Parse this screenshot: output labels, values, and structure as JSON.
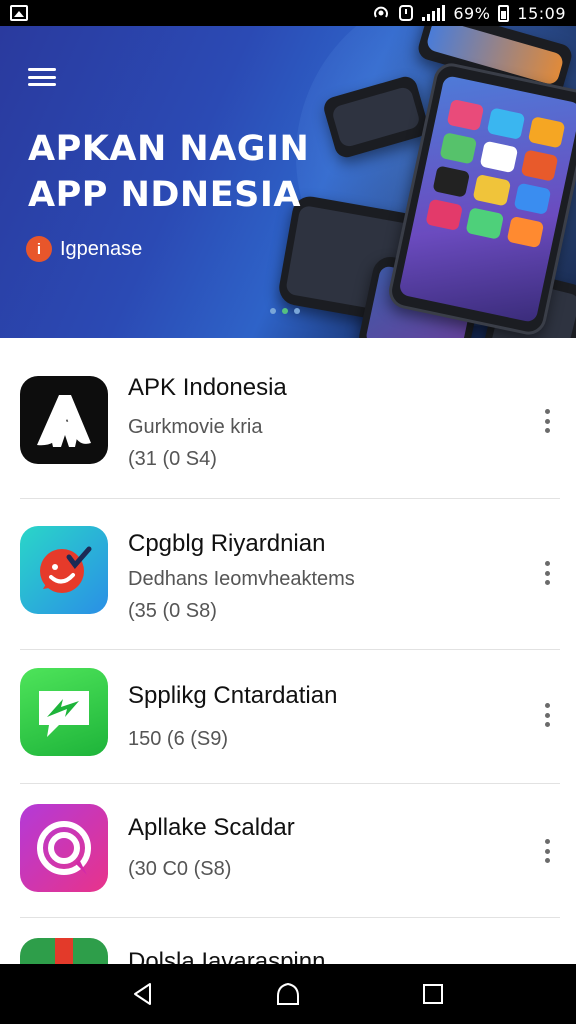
{
  "status_bar": {
    "battery_text": "69%",
    "time": "15:09",
    "icons": [
      "gallery-icon",
      "hotspot-icon",
      "alarm-icon",
      "signal-icon",
      "battery-icon"
    ]
  },
  "banner": {
    "title_line1": "APKAN NAGIN",
    "title_line2": "APP NDNESIA",
    "brand": "Igpenase",
    "brand_logo_glyph": "i",
    "slide_count": 3,
    "active_slide": 2
  },
  "apps": [
    {
      "name": "APK Indonesia",
      "subtitle": "Gurkmovie kria",
      "meta": "(31 (0 S4)",
      "icon": "apk-logo-icon",
      "colors": [
        "#0d0d0d"
      ]
    },
    {
      "name": "Cpgblg Riyardnian",
      "subtitle": "Dedhans Ieomvheaktems",
      "meta": "(35 (0 S8)",
      "icon": "chat-bubble-face-icon",
      "colors": [
        "#2ad6c8",
        "#2a8fe6",
        "#e63a2a"
      ]
    },
    {
      "name": "Spplikg Cntardatian",
      "subtitle": "",
      "meta": "150 (6 (S9)",
      "icon": "message-arrow-icon",
      "colors": [
        "#4ee45a",
        "#1eb43a"
      ]
    },
    {
      "name": "Apllake Scaldar",
      "subtitle": "",
      "meta": "(30 C0 (S8)",
      "icon": "target-swirl-icon",
      "colors": [
        "#d22aa8",
        "#b33ad8",
        "#e8338a"
      ]
    },
    {
      "name": "Dolsla Iavaraspinn",
      "subtitle": "",
      "meta": "",
      "icon": "partial-app-icon",
      "colors": [
        "#2e9e4a",
        "#e33a2a"
      ]
    }
  ],
  "navigation": {
    "back": "back-icon",
    "home": "home-icon",
    "recents": "recents-icon"
  }
}
